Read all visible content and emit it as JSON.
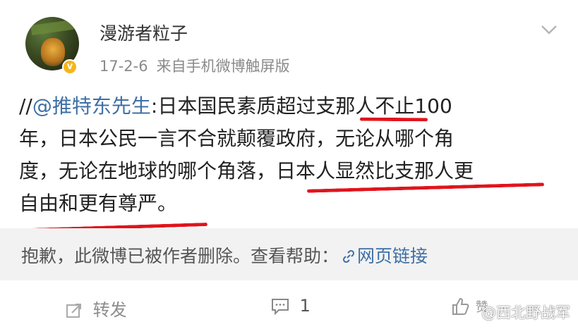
{
  "post": {
    "author": "漫游者粒子",
    "date": "17-2-6",
    "source": "来自手机微博触屏版",
    "text": {
      "prefix": "//",
      "mention": "@推特东先生",
      "line1_rest": ":日本国民素质超过支那人不止100",
      "line2": "年，日本公民一言不合就颠覆政府，无论从哪个角",
      "line3": "度，无论在地球的哪个角落，日本人显然比支那人更",
      "line4": "自由和更有尊严。"
    }
  },
  "deleted_notice": {
    "text": "抱歉，此微博已被作者删除。查看帮助：",
    "link": "网页链接"
  },
  "actions": {
    "repost": "转发",
    "comments": "1",
    "like_label": "赞"
  },
  "watermark": "@西北野战军",
  "colors": {
    "link": "#3e6fa6",
    "underline": "#e0141c",
    "badge": "#f6b51a"
  }
}
